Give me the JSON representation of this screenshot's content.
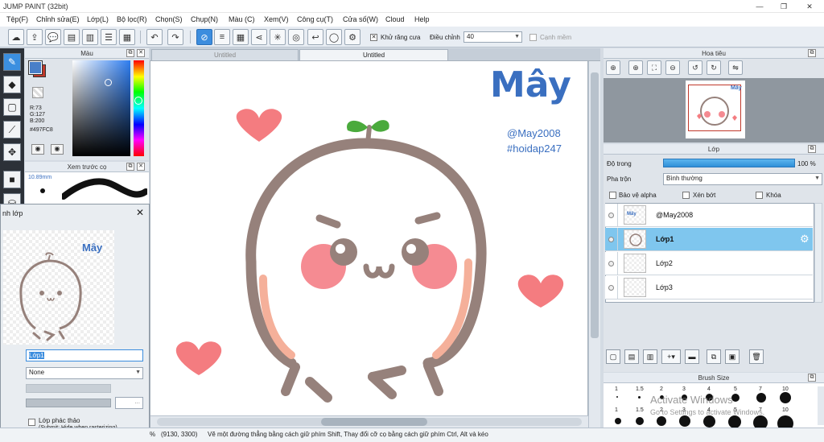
{
  "window": {
    "title": "JUMP PAINT (32bit)",
    "minimize": "—",
    "restore": "❐",
    "close": "✕"
  },
  "menu": [
    "Tệp(F)",
    "Chỉnh sửa(E)",
    "Lớp(L)",
    "Bộ lọc(R)",
    "Chọn(S)",
    "Chụp(N)",
    "Màu (C)",
    "Xem(V)",
    "Công cụ(T)",
    "Cửa số(W)",
    "Cloud",
    "Help"
  ],
  "toolbar": {
    "antialias_label": "Khử răng cưa",
    "adjust_label": "Điều chỉnh",
    "adjust_value": "40",
    "canh_mem_label": "Cạnh mềm"
  },
  "tabs": [
    "Untitled",
    "Untitled"
  ],
  "color_panel": {
    "title": "Màu",
    "r": "R:73",
    "g": "G:127",
    "b": "B:200",
    "hex": "#497FC8",
    "fg_color": "#497fc8",
    "bg_color": "#c0392b"
  },
  "brush_preview": {
    "title": "Xem trước cọ",
    "size": "10.89mm"
  },
  "dialog": {
    "title": "nh lớp",
    "layer_name": "Lớp1",
    "blend": "None",
    "rasterize_label": "Lớp phác thảo",
    "rasterize_note": "(Submit: Hide when rasterizing)",
    "ellipsis": "..."
  },
  "canvas_art": {
    "logo": "Mây",
    "line1": "@May2008",
    "line2": "#hoidap247"
  },
  "navigator": {
    "title": "Hoa tiêu"
  },
  "layers": {
    "title": "Lớp",
    "opacity_label": "Độ trong",
    "opacity_value": "100 %",
    "blend_label": "Pha trộn",
    "blend_value": "Bình thường",
    "protect_alpha": "Bảo vệ alpha",
    "clip": "Xén bớt",
    "lock": "Khóa",
    "items": [
      {
        "name": "@May2008",
        "active": false
      },
      {
        "name": "Lớp1",
        "active": true
      },
      {
        "name": "Lớp2",
        "active": false
      },
      {
        "name": "Lớp3",
        "active": false
      }
    ]
  },
  "brush_size": {
    "title": "Brush Size",
    "top_row": [
      "1",
      "1.5",
      "2",
      "3",
      "4",
      "5",
      "7",
      "10"
    ],
    "bottom_row": [
      "1",
      "1.5",
      "2",
      "3",
      "4",
      "5",
      "7",
      "10"
    ]
  },
  "watermark": {
    "line1": "Activate Windows",
    "line2": "Go to Settings to activate Windows."
  },
  "status": {
    "coords": "(9130, 3300)",
    "zoom_suffix": "%",
    "hint": "Vẽ một đường thẳng bằng cách giữ phím Shift, Thay đổi cỡ cọ bằng cách giữ phím Ctrl, Alt và kéo"
  },
  "colors": {
    "logo_blue": "#3a6fc0",
    "accent_pink": "#f47c80",
    "outline": "#96817b",
    "cheek": "#f58b92",
    "leaf": "#4aaa3c"
  }
}
